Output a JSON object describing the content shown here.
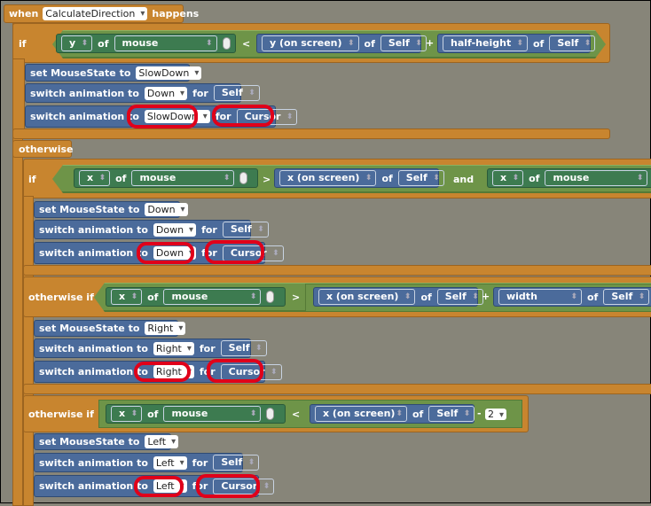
{
  "event": {
    "when": "when",
    "name": "CalculateDirection",
    "happens": "happens"
  },
  "kw": {
    "if": "if",
    "otherwise": "otherwise",
    "otherwise_if": "otherwise if",
    "of": "of",
    "for": "for",
    "and": "and",
    "set": "set MouseState to",
    "switch": "switch animation to",
    "lt": "<",
    "gt": ">",
    "plus": "+",
    "minus": "-"
  },
  "cond1": {
    "attr": "y",
    "obj": "mouse",
    "screen": "y (on screen)",
    "self": "Self",
    "extra": "half-height"
  },
  "cond2": {
    "attr": "x",
    "obj": "mouse",
    "screen": "x (on screen)",
    "self": "Self",
    "attr2": "x",
    "obj2": "mouse"
  },
  "cond3": {
    "attr": "x",
    "obj": "mouse",
    "screen": "x (on screen)",
    "self": "Self",
    "extra": "width"
  },
  "cond4": {
    "attr": "x",
    "obj": "mouse",
    "screen": "x (on screen)",
    "self": "Self",
    "num": "2"
  },
  "b1": {
    "state": "SlowDown",
    "anim1": "Down",
    "actor1": "Self",
    "anim2": "SlowDown",
    "actor2": "Cursor"
  },
  "b2": {
    "state": "Down",
    "anim1": "Down",
    "actor1": "Self",
    "anim2": "Down",
    "actor2": "Cursor"
  },
  "b3": {
    "state": "Right",
    "anim1": "Right",
    "actor1": "Self",
    "anim2": "Right",
    "actor2": "Cursor"
  },
  "b4": {
    "state": "Left",
    "anim1": "Left",
    "actor1": "Self",
    "anim2": "Left",
    "actor2": "Cursor"
  },
  "colors": {
    "event": "#c8852f",
    "condition": "#6e9448",
    "sensor": "#3d7b50",
    "action": "#4b6b9b",
    "highlight": "#e0001a"
  }
}
